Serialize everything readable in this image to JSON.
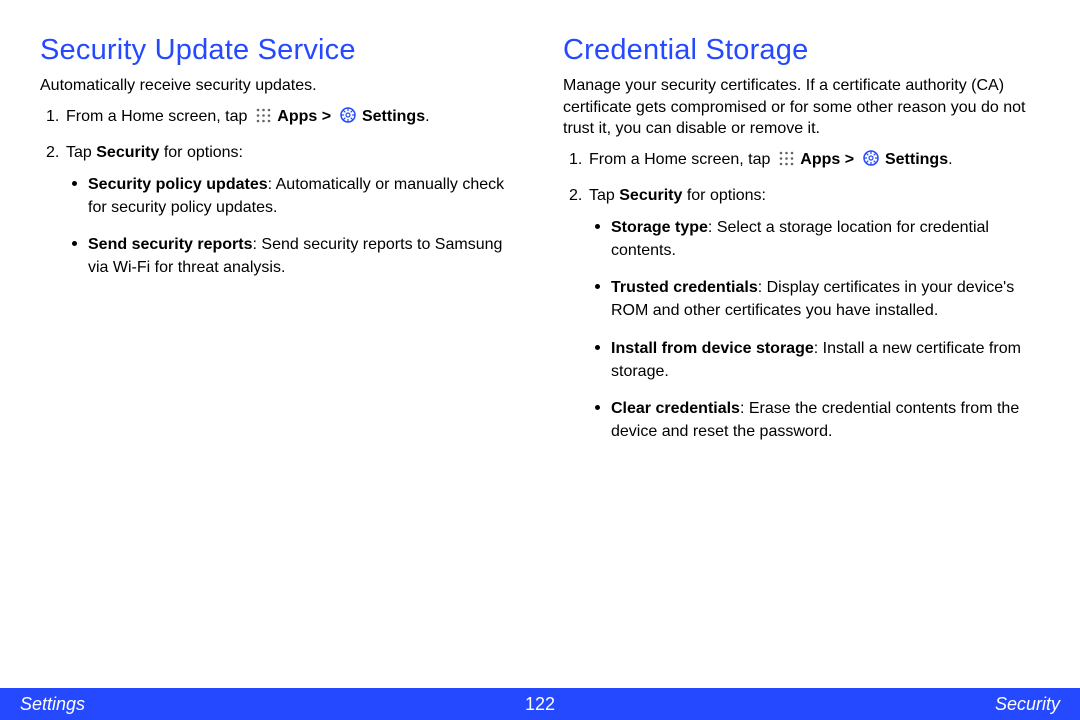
{
  "left": {
    "heading": "Security Update Service",
    "intro": "Automatically receive security updates.",
    "step1_pre": "From a Home screen, tap ",
    "apps_label": "Apps",
    "sep": " > ",
    "settings_label": "Settings",
    "period": ".",
    "step2_pre": "Tap ",
    "step2_bold": "Security",
    "step2_post": " for options:",
    "bullets": [
      {
        "bold": "Security policy updates",
        "rest": ": Automatically or manually check for security policy updates."
      },
      {
        "bold": "Send security reports",
        "rest": ": Send security reports to Samsung via Wi-Fi for threat analysis."
      }
    ]
  },
  "right": {
    "heading": "Credential Storage",
    "intro": "Manage your security certificates. If a certificate authority (CA) certificate gets compromised or for some other reason you do not trust it, you can disable or remove it.",
    "step1_pre": "From a Home screen, tap ",
    "apps_label": "Apps",
    "sep": " > ",
    "settings_label": "Settings",
    "period": ".",
    "step2_pre": "Tap ",
    "step2_bold": "Security",
    "step2_post": " for options:",
    "bullets": [
      {
        "bold": "Storage type",
        "rest": ": Select a storage location for credential contents."
      },
      {
        "bold": "Trusted credentials",
        "rest": ": Display certificates in your device's ROM and other certificates you have installed."
      },
      {
        "bold": "Install from device storage",
        "rest": ": Install a new certificate from storage."
      },
      {
        "bold": "Clear credentials",
        "rest": ": Erase the credential contents from the device and reset the password."
      }
    ]
  },
  "footer": {
    "left": "Settings",
    "mid": "122",
    "right": "Security"
  }
}
